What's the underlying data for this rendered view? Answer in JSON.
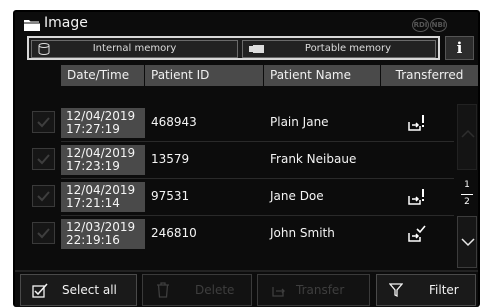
{
  "window": {
    "title": "Image",
    "icon": "folder-icon",
    "badges": [
      "RDI",
      "NBI"
    ]
  },
  "memory": {
    "internal_label": "Internal memory",
    "portable_label": "Portable memory"
  },
  "info": {
    "label": "i"
  },
  "table": {
    "headers": {
      "date": "Date/Time",
      "pid": "Patient ID",
      "name": "Patient Name",
      "transferred": "Transferred"
    },
    "rows": [
      {
        "date": "12/04/2019",
        "time": "17:27:19",
        "pid": "468943",
        "name": "Plain Jane",
        "transfer_status": "export-warning-icon"
      },
      {
        "date": "12/04/2019",
        "time": "17:23:19",
        "pid": "13579",
        "name": "Frank Neibaue",
        "transfer_status": ""
      },
      {
        "date": "12/04/2019",
        "time": "17:21:14",
        "pid": "97531",
        "name": "Jane Doe",
        "transfer_status": "export-warning-icon"
      },
      {
        "date": "12/03/2019",
        "time": "22:19:16",
        "pid": "246810",
        "name": "John Smith",
        "transfer_status": "export-done-icon"
      }
    ]
  },
  "pagination": {
    "current": "1",
    "total": "2"
  },
  "toolbar": {
    "select_all": "Select all",
    "delete": "Delete",
    "transfer": "Transfer",
    "filter": "Filter"
  },
  "colors": {
    "background": "#0c0c0c",
    "header": "#4a4a4a",
    "text": "#f5f5f5",
    "disabled": "#3e3e3e",
    "highlight_border": "#d8d8d8"
  }
}
